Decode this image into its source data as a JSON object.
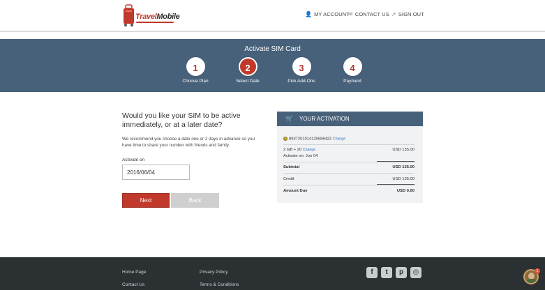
{
  "header": {
    "logo": {
      "brand_a": "Travel",
      "brand_b": "Mobile"
    },
    "nav": [
      {
        "icon": "user-icon",
        "label": "MY ACCOUNT"
      },
      {
        "icon": "envelope-icon",
        "label": "CONTACT US"
      },
      {
        "icon": "sign-out-icon",
        "label": "SIGN OUT"
      }
    ]
  },
  "banner": {
    "title": "Activate SIM Card",
    "steps": [
      {
        "number": "1",
        "label": "Choose Plan",
        "active": false
      },
      {
        "number": "2",
        "label": "Select Date",
        "active": true
      },
      {
        "number": "3",
        "label": "Pick Add-Ons",
        "active": false
      },
      {
        "number": "4",
        "label": "Payment",
        "active": false
      }
    ]
  },
  "form": {
    "question": "Would you like your SIM to be active immediately, or at a later date?",
    "description": "We recommend you choose a date one or 2 days in advance so you have time to share your number with friends and family.",
    "activate_label": "Activate on",
    "activate_value": "2016/06/04",
    "next_label": "Next",
    "back_label": "Back"
  },
  "activation": {
    "title": "YOUR ACTIVATION",
    "sim_number": "8937201014120688422",
    "change_label": "Change",
    "plan_line": "2 GB + 20",
    "plan_change_label": "Change",
    "plan_amount": "USD 135.00",
    "activate_line": "Activate on: Jun 04",
    "subtotal_label": "Subtotal",
    "subtotal_amount": "USD 135.00",
    "credit_label": "Credit",
    "credit_amount": "USD 135.00",
    "amount_due_label": "Amount Due",
    "amount_due_amount": "USD 0.00"
  },
  "footer": {
    "links": [
      "Home Page",
      "Privacy Policy",
      "Contact Us",
      "Terms & Conditions"
    ],
    "social": [
      {
        "icon": "facebook-icon",
        "glyph": "f"
      },
      {
        "icon": "twitter-icon",
        "glyph": "t"
      },
      {
        "icon": "pinterest-icon",
        "glyph": "p"
      },
      {
        "icon": "instagram-icon",
        "glyph": "◎"
      }
    ],
    "notification_count": "1"
  },
  "colors": {
    "brand_red": "#c0392b",
    "banner_blue": "#47617a",
    "footer_dark": "#2b3033"
  }
}
